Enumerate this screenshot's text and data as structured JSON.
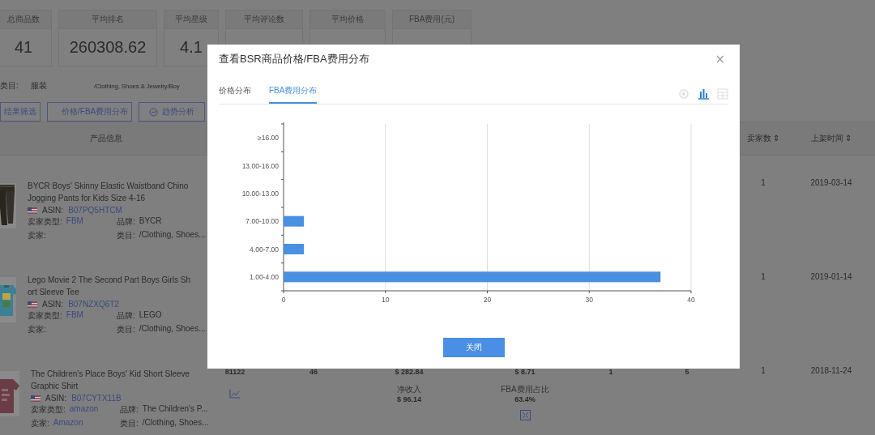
{
  "stats": [
    {
      "label": "总商品数",
      "value": "41"
    },
    {
      "label": "平均排名",
      "value": "260308.62"
    },
    {
      "label": "平均星级",
      "value": "4.1"
    },
    {
      "label": "平均评论数"
    },
    {
      "label": "平均价格"
    },
    {
      "label": "FBA费用(元)"
    }
  ],
  "filter": {
    "label": "类目:",
    "value": "服装",
    "path": "/Clothing, Shoes & Jewelry/Boy"
  },
  "actions": [
    {
      "label": "结果筛选",
      "kind": "plain"
    },
    {
      "label": "价格/FBA费用分布",
      "kind": "info"
    },
    {
      "label": "趋势分析",
      "kind": "trend"
    }
  ],
  "table": {
    "columns": [
      {
        "label": "产品信息"
      },
      {
        "label": "卖家数 ⇕"
      },
      {
        "label": "上架时间 ⇕"
      }
    ],
    "rows": [
      {
        "title": "BYCR Boys' Skinny Elastic Waistband Chino Jogging Pants for Kids Size 4-16",
        "asin_label": "ASIN:",
        "asin": "B07PQ5HTCM",
        "seller_type_label": "卖家类型:",
        "seller_type": "FBM",
        "brand_label": "品牌:",
        "brand": "BYCR",
        "seller_label": "卖家:",
        "category_label": "类目:",
        "category": "/Clothing, Shoes...",
        "sellers": "1",
        "date": "2019-03-14"
      },
      {
        "title": "Lego Movie 2 The Second Part Boys Girls Short Sleeve Tee",
        "asin_label": "ASIN:",
        "asin": "B07NZXQ6T2",
        "seller_type_label": "卖家类型:",
        "seller_type": "FBM",
        "brand_label": "品牌:",
        "brand": "LEGO",
        "seller_label": "卖家:",
        "category_label": "类目:",
        "category": "/Clothing, Shoes...",
        "sellers": "1",
        "date": "2019-01-14"
      },
      {
        "title": "The Children's Place Boys' Kid Short Sleeve Graphic Shirt",
        "asin_label": "ASIN:",
        "asin": "B07CYTX11B",
        "seller_type_label": "卖家类型:",
        "seller_type": "amazon",
        "brand_label": "品牌:",
        "brand": "The Children's P...",
        "seller_label": "卖家:",
        "seller": "Amazon",
        "category_label": "类目:",
        "category": "/Clothing, Shoes...",
        "sellers": "1",
        "date": "2018-11-24",
        "metrics": [
          "81122",
          "46",
          "$ 282.84",
          "$ 8.71",
          "1",
          "5"
        ],
        "net_label": "净收入",
        "net": "$ 96.14",
        "fba_ratio_label": "FBA费用占比",
        "fba_ratio": "63.4%"
      }
    ]
  },
  "modal": {
    "title": "查看BSR商品价格/FBA费用分布",
    "close": "×",
    "tabs": [
      {
        "label": "价格分布",
        "selected": false
      },
      {
        "label": "FBA费用分布",
        "selected": true
      }
    ],
    "views": [
      {
        "kind": "settings",
        "selected": false
      },
      {
        "kind": "bar",
        "selected": true
      },
      {
        "kind": "table",
        "selected": false
      }
    ],
    "chart_data": {
      "type": "bar",
      "orientation": "horizontal",
      "grid": true,
      "categories": [
        "≥16.00",
        "13.00-16.00",
        "10.00-13.00",
        "7.00-10.00",
        "4.00-7.00",
        "1.00-4.00"
      ],
      "values": [
        0,
        0,
        0,
        2,
        2,
        37
      ],
      "xlim": [
        0,
        40
      ],
      "xticks": [
        0,
        10,
        20,
        30,
        40
      ]
    },
    "button": "关闭"
  }
}
